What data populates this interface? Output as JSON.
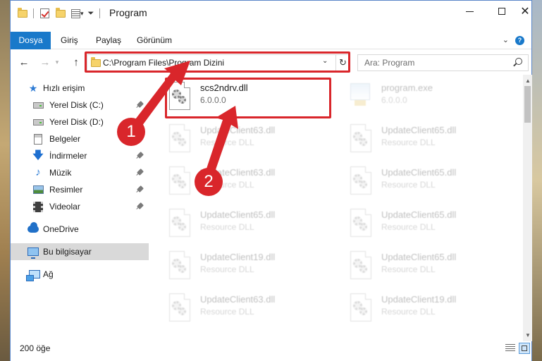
{
  "window": {
    "title": "Program",
    "minimize_glyph": "",
    "maximize_glyph": "",
    "close_glyph": "✕"
  },
  "ribbon": {
    "tabs": [
      "Dosya",
      "Giriş",
      "Paylaş",
      "Görünüm"
    ],
    "help_glyph": "?",
    "collapse_glyph": "⌄"
  },
  "nav": {
    "back_glyph": "←",
    "forward_glyph": "→",
    "up_glyph": "↑",
    "address": "C:\\Program Files\\Program Dizini",
    "dropdown_glyph": "⌄",
    "refresh_glyph": "↻",
    "search_placeholder": "Ara: Program"
  },
  "sidebar": {
    "items": [
      {
        "label": "Hızlı erişim",
        "icon": "star-icon",
        "pinned": false
      },
      {
        "label": "Yerel Disk (C:)",
        "icon": "drive-icon",
        "pinned": true
      },
      {
        "label": "Yerel Disk (D:)",
        "icon": "drive-icon",
        "pinned": false
      },
      {
        "label": "Belgeler",
        "icon": "documents-icon",
        "pinned": true
      },
      {
        "label": "İndirmeler",
        "icon": "downloads-icon",
        "pinned": true
      },
      {
        "label": "Müzik",
        "icon": "music-icon",
        "pinned": true
      },
      {
        "label": "Resimler",
        "icon": "pictures-icon",
        "pinned": true
      },
      {
        "label": "Videolar",
        "icon": "videos-icon",
        "pinned": true
      },
      {
        "label": "OneDrive",
        "icon": "onedrive-icon",
        "pinned": false
      },
      {
        "label": "Bu bilgisayar",
        "icon": "this-pc-icon",
        "pinned": false,
        "selected": true
      },
      {
        "label": "Ağ",
        "icon": "network-icon",
        "pinned": false
      }
    ]
  },
  "files": [
    {
      "name": "scs2ndrv.dll",
      "sub": "6.0.0.0",
      "highlight": true
    },
    {
      "name": "program.exe",
      "sub": "6.0.0.0",
      "faded": true
    },
    {
      "name": "UpdateClient63.dll",
      "sub": "Resource DLL",
      "faded": true
    },
    {
      "name": "UpdateClient65.dll",
      "sub": "Resource DLL",
      "faded": true
    },
    {
      "name": "UpdateClient63.dll",
      "sub": "Resource DLL",
      "faded": true
    },
    {
      "name": "UpdateClient65.dll",
      "sub": "Resource DLL",
      "faded": true
    },
    {
      "name": "UpdateClient65.dll",
      "sub": "Resource DLL",
      "faded": true
    },
    {
      "name": "UpdateClient65.dll",
      "sub": "Resource DLL",
      "faded": true
    },
    {
      "name": "UpdateClient19.dll",
      "sub": "Resource DLL",
      "faded": true
    },
    {
      "name": "UpdateClient65.dll",
      "sub": "Resource DLL",
      "faded": true
    },
    {
      "name": "UpdateClient63.dll",
      "sub": "Resource DLL",
      "faded": true
    },
    {
      "name": "UpdateClient19.dll",
      "sub": "Resource DLL",
      "faded": true
    }
  ],
  "status": {
    "item_count": "200 öğe"
  },
  "callouts": [
    "1",
    "2"
  ],
  "colors": {
    "accent": "#1979ca",
    "highlight_box": "#d9262b",
    "selected_nav": "#d9d9d9"
  }
}
